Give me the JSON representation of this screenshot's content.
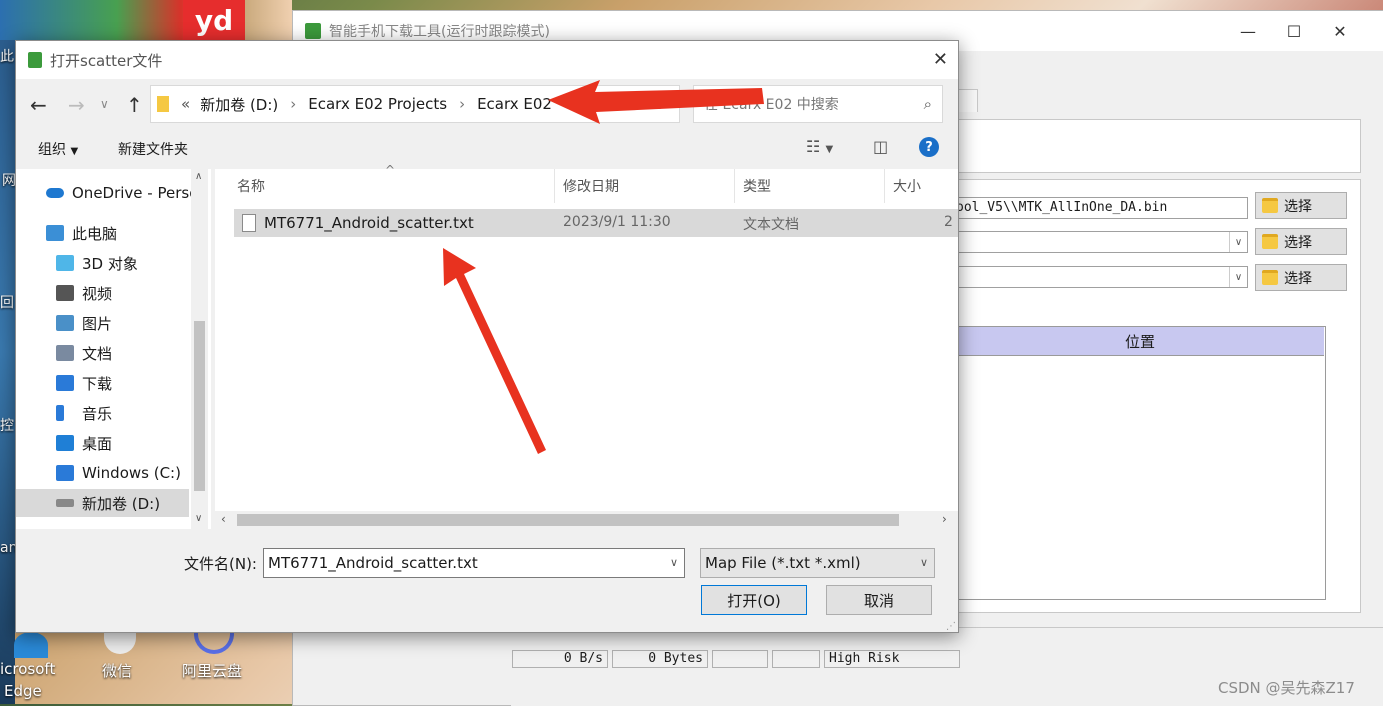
{
  "desktop": {
    "icons": [
      {
        "label": "此",
        "x": 0
      },
      {
        "label": "网",
        "x": 0
      },
      {
        "label": "回",
        "x": 0
      },
      {
        "label": "控",
        "x": 0
      },
      {
        "label": "an",
        "x": 0
      }
    ],
    "bottom_icons": {
      "edge_label_1": "icrosoft",
      "edge_label_2": "Edge",
      "wechat": "微信",
      "aliyun": "阿里云盘"
    },
    "top_badge": "yd"
  },
  "bg_window": {
    "title": "智能手机下载工具(运行时跟踪模式)",
    "da_path": "ool_V5\\\\MTK_AllInOne_DA.bin",
    "select_label": "选择",
    "table_header_location": "位置",
    "status": {
      "speed": "0 B/s",
      "bytes": "0 Bytes",
      "mode": "High Risk"
    },
    "controls": {
      "minimize": "—",
      "maximize": "☐",
      "close": "✕"
    }
  },
  "dialog": {
    "title": "打开scatter文件",
    "close": "✕",
    "breadcrumb": {
      "chevrons": "«",
      "parts": [
        "新加卷 (D:)",
        "Ecarx E02 Projects",
        "Ecarx E02"
      ]
    },
    "search_placeholder": "在 Ecarx E02 中搜索",
    "toolbar": {
      "organize": "组织",
      "new_folder": "新建文件夹",
      "help": "?"
    },
    "nav": [
      {
        "label": "OneDrive - Perso",
        "icon": "onedrive-icon",
        "color": "#1e78d0"
      },
      {
        "label": "此电脑",
        "icon": "computer-icon",
        "color": "#3b8fd6"
      },
      {
        "label": "3D 对象",
        "icon": "3d-objects-icon",
        "color": "#4fb6e8"
      },
      {
        "label": "视频",
        "icon": "video-icon",
        "color": "#555"
      },
      {
        "label": "图片",
        "icon": "picture-icon",
        "color": "#4a90c8"
      },
      {
        "label": "文档",
        "icon": "document-icon",
        "color": "#7a8aa0"
      },
      {
        "label": "下载",
        "icon": "download-icon",
        "color": "#2a7ad8"
      },
      {
        "label": "音乐",
        "icon": "music-icon",
        "color": "#2a7ad8"
      },
      {
        "label": "桌面",
        "icon": "desktop-icon",
        "color": "#1f7fd6"
      },
      {
        "label": "Windows (C:)",
        "icon": "windows-drive-icon",
        "color": "#2a7ad8"
      },
      {
        "label": "新加卷 (D:)",
        "icon": "drive-icon",
        "color": "#888"
      }
    ],
    "columns": {
      "name": "名称",
      "modified": "修改日期",
      "type": "类型",
      "size": "大小"
    },
    "files": [
      {
        "name": "MT6771_Android_scatter.txt",
        "modified": "2023/9/1 11:30",
        "type": "文本文档",
        "size": "2"
      }
    ],
    "filename_label": "文件名(N):",
    "filename_value": "MT6771_Android_scatter.txt",
    "filter_value": "Map File (*.txt *.xml)",
    "open_button": "打开(O)",
    "cancel_button": "取消"
  },
  "watermark": "CSDN @吴先森Z17",
  "colors": {
    "arrow": "#e8321f",
    "selected_row": "#cce8ff",
    "header_purple": "#c8c8f0"
  }
}
